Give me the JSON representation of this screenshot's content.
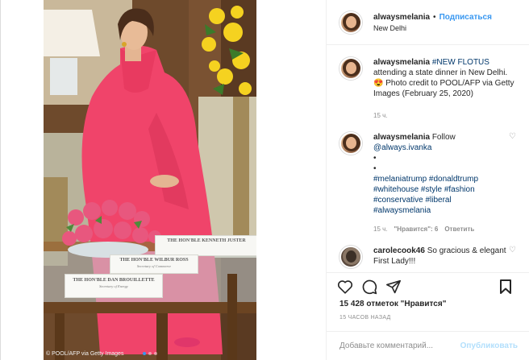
{
  "photo": {
    "credit": "© POOL/AFP via Getty Images",
    "place_cards": [
      "THE HON'BLE KENNETH JUSTER",
      "THE HON'BLE WILBUR ROSS",
      "THE HON'BLE DAN BROUILLETTE"
    ],
    "place_card_roles": [
      "Secretary of Commerce",
      "Secretary of Energy"
    ],
    "dots": 3
  },
  "header": {
    "username": "alwaysmelania",
    "separator": "•",
    "follow_label": "Подписаться",
    "location": "New Delhi"
  },
  "caption": {
    "username": "alwaysmelania",
    "hashtag": "#NEW FLOTUS",
    "text": "attending a state dinner in New Delhi. 😍 Photo credit to POOL/AFP via Getty Images (February 25, 2020)",
    "time": "15 ч."
  },
  "comments": [
    {
      "username": "alwaysmelania",
      "text": "Follow",
      "mention": "@always.ivanka",
      "bullets": [
        "•",
        "•"
      ],
      "tags": [
        "#melaniatrump #donaldtrump",
        "#whitehouse #style #fashion",
        "#conservative #liberal",
        "#alwaysmelania"
      ],
      "time": "15 ч.",
      "likes_label": "\"Нравится\": 6",
      "reply_label": "Ответить"
    },
    {
      "username": "carolecook46",
      "text": "So gracious & elegant First Lady!!!"
    }
  ],
  "actions": {
    "likes": "15 428 отметок \"Нравится\"",
    "timestamp": "15 ЧАСОВ НАЗАД"
  },
  "add_comment": {
    "placeholder": "Добавьте комментарий...",
    "publish_label": "Опубликовать"
  },
  "colors": {
    "link": "#3897f0",
    "hashtag": "#00376b",
    "muted": "#8e8e8e",
    "dress": "#f0446a"
  }
}
